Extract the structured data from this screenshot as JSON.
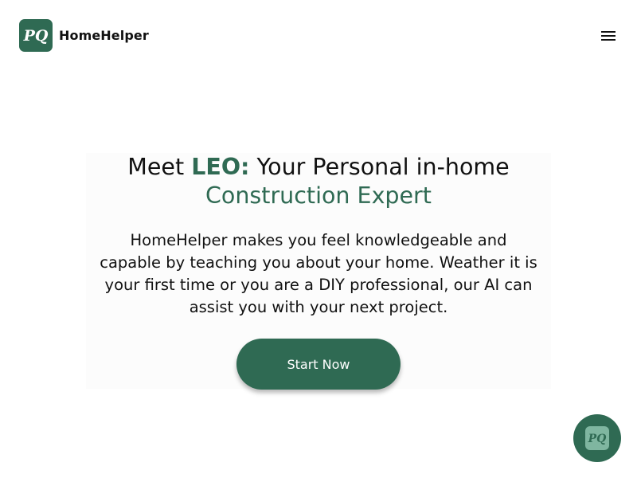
{
  "header": {
    "brand_name": "HomeHelper",
    "logo_icon": "pq-logo-icon",
    "menu_icon": "hamburger-menu-icon"
  },
  "hero": {
    "headline_prefix": "Meet ",
    "headline_accent": "LEO:",
    "headline_rest": " Your Personal in-home",
    "headline_line2": "Construction Expert",
    "description_lines": [
      "HomeHelper makes you feel knowledgeable and",
      "capable by teaching you about your home. Weather it is",
      "your first time or you are a DIY professional, our AI can",
      "assist you with your next project."
    ],
    "cta_label": "Start Now"
  },
  "chat_widget": {
    "icon": "pq-chat-logo-icon"
  },
  "colors": {
    "brand": "#2f6a53",
    "brand_light": "#7fb6a0",
    "text": "#111111",
    "background": "#ffffff"
  }
}
